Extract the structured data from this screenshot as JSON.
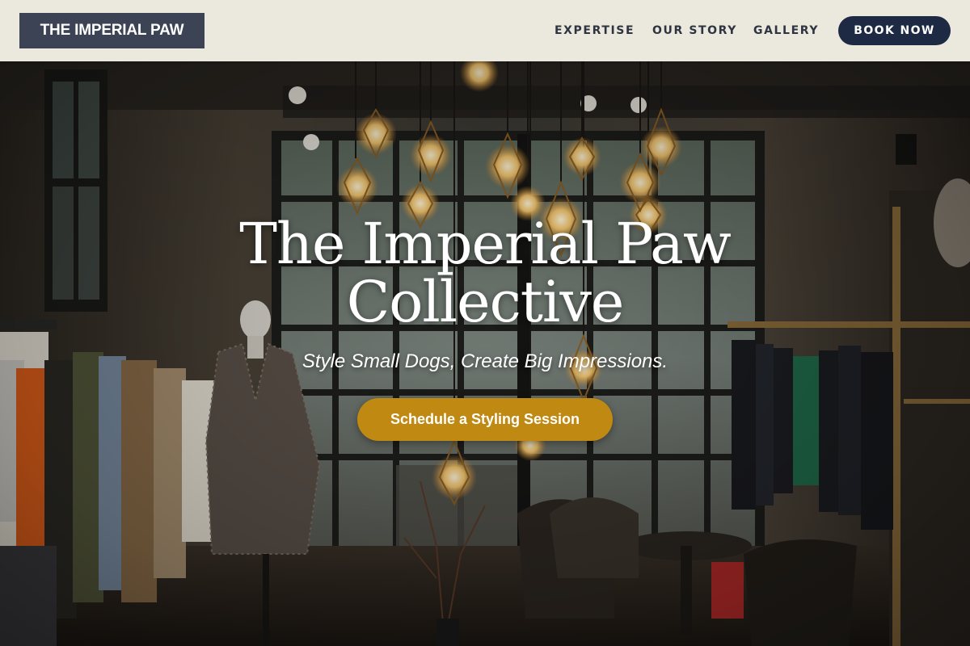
{
  "header": {
    "logo_text": "THE IMPERIAL PAW",
    "nav": [
      {
        "label": "EXPERTISE"
      },
      {
        "label": "OUR STORY"
      },
      {
        "label": "GALLERY"
      }
    ],
    "cta_label": "BOOK NOW"
  },
  "hero": {
    "title_line1": "The Imperial Paw",
    "title_line2": "Collective",
    "subtitle": "Style Small Dogs, Create Big Impressions.",
    "cta_label": "Schedule a Styling Session",
    "background_image": "boutique-interior-photo"
  },
  "colors": {
    "header_bg": "#ebe8dd",
    "logo_bg": "#3b4355",
    "nav_text": "#2e3440",
    "book_button": "#1e2a44",
    "cta_gold": "#c08912"
  }
}
